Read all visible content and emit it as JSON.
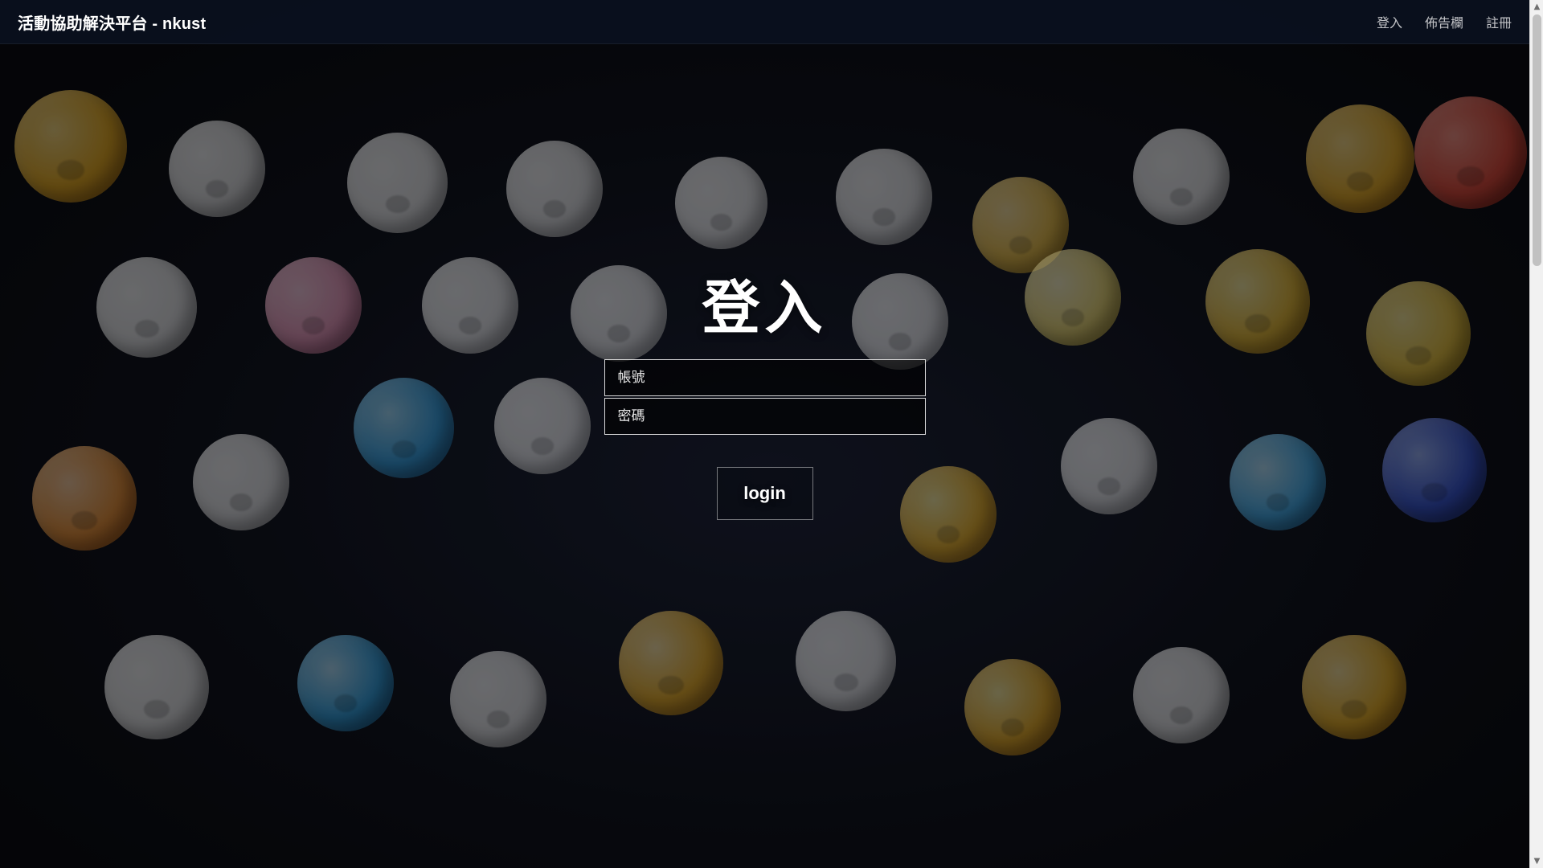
{
  "navbar": {
    "brand": "活動協助解決平台 - nkust",
    "links": [
      "登入",
      "佈告欄",
      "註冊"
    ]
  },
  "login": {
    "title": "登入",
    "username_placeholder": "帳號",
    "password_placeholder": "密碼",
    "submit_label": "login"
  },
  "scrollbar": {
    "up_glyph": "▲",
    "down_glyph": "▼"
  },
  "colors": {
    "navbar_bg": "#0A1222",
    "text": "#FFFFFF",
    "scrollbar_track": "#F1F1F1",
    "scrollbar_thumb": "#C1C1C1"
  }
}
